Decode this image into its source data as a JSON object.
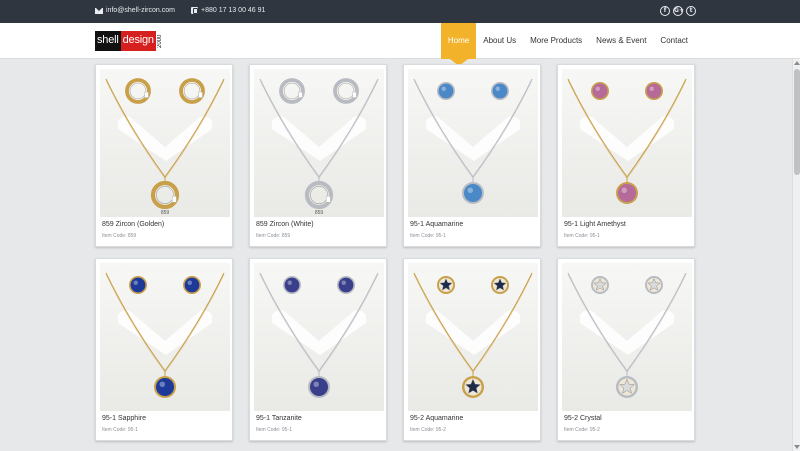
{
  "topbar": {
    "email": "info@shell-zircon.com",
    "phone": "+880 17 13 00 46 91",
    "social": [
      "f",
      "G+",
      "t"
    ]
  },
  "logo": {
    "part1": "shell",
    "part2": "design",
    "part3": "2000"
  },
  "nav": [
    {
      "label": "Home",
      "active": true
    },
    {
      "label": "About Us"
    },
    {
      "label": "More Products"
    },
    {
      "label": "News & Event"
    },
    {
      "label": "Contact"
    }
  ],
  "products": [
    {
      "name": "859 Zircon (Golden)",
      "code": "Item Code: 859",
      "stone": "ring",
      "metal": "#c9a04a",
      "gem": "#6a6a6a",
      "tag": "859"
    },
    {
      "name": "859 Zircon (White)",
      "code": "Item Code: 859",
      "stone": "ring",
      "metal": "#b8bcc2",
      "gem": "#6a6a6a",
      "tag": "859"
    },
    {
      "name": "95-1 Aquamarine",
      "code": "Item Code: 95-1",
      "stone": "round",
      "metal": "#b8bcc2",
      "gem": "#4a88c8"
    },
    {
      "name": "95-1 Light Amethyst",
      "code": "Item Code: 95-1",
      "stone": "round",
      "metal": "#c9a04a",
      "gem": "#b56a9a"
    },
    {
      "name": "95-1 Sapphire",
      "code": "Item Code: 95-1",
      "stone": "round",
      "metal": "#c9a04a",
      "gem": "#1d3a9a"
    },
    {
      "name": "95-1 Tanzanite",
      "code": "Item Code: 95-1",
      "stone": "round",
      "metal": "#b8bcc2",
      "gem": "#3a3f8c"
    },
    {
      "name": "95-2 Aquamarine",
      "code": "Item Code: 95-2",
      "stone": "star",
      "metal": "#c9a04a",
      "gem": "#1e2a4a"
    },
    {
      "name": "95-2 Crystal",
      "code": "Item Code: 95-2",
      "stone": "star",
      "metal": "#b8bcc2",
      "gem": "#d8dadc"
    }
  ]
}
